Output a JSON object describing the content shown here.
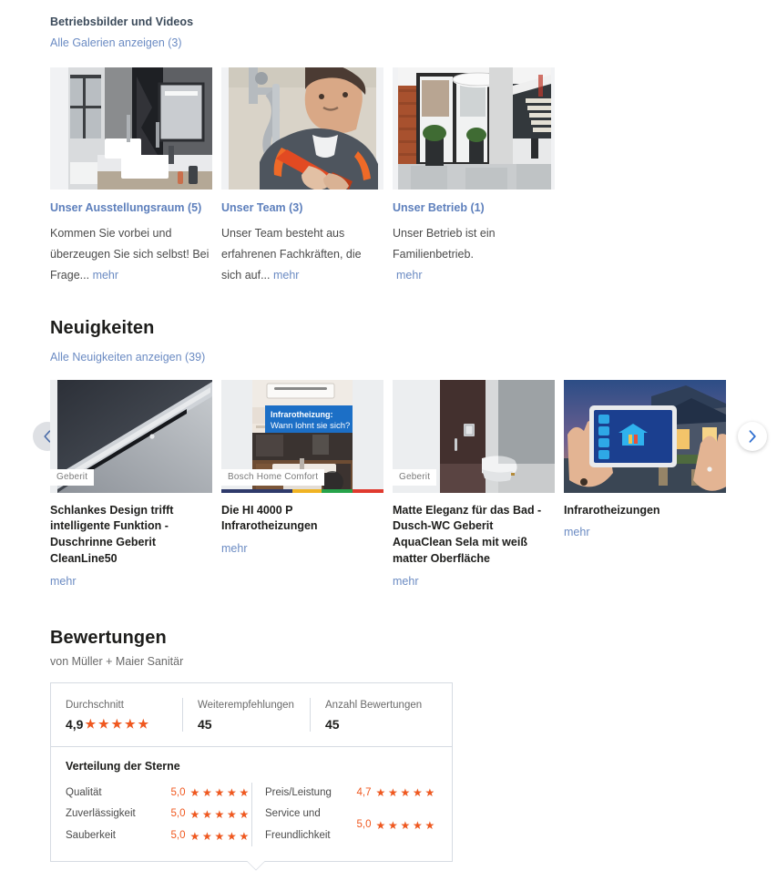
{
  "galleries": {
    "heading": "Betriebsbilder und Videos",
    "all_link": "Alle Galerien anzeigen (3)",
    "items": [
      {
        "title": "Unser Ausstellungsraum (5)",
        "desc": "Kommen Sie vorbei und überzeugen Sie sich selbst! Bei Frage...",
        "more": "mehr",
        "image_alt": "bathroom-showroom-photo"
      },
      {
        "title": "Unser Team (3)",
        "desc": "Unser Team besteht aus erfahrenen Fachkräften, die sich auf...",
        "more": "mehr",
        "image_alt": "plumber-at-work-photo"
      },
      {
        "title": "Unser Betrieb (1)",
        "desc": "Unser Betrieb ist ein Familienbetrieb.",
        "more": "mehr",
        "image_alt": "company-entrance-photo"
      }
    ]
  },
  "news": {
    "heading": "Neuigkeiten",
    "all_link": "Alle Neuigkeiten anzeigen (39)",
    "prev_label": "‹",
    "next_label": "›",
    "items": [
      {
        "title": "Schlankes Design trifft intelligente Funktion - Duschrinne Geberit CleanLine50",
        "more": "mehr",
        "brand": "Geberit",
        "image_alt": "shower-drain-photo"
      },
      {
        "title": "Die HI 4000 P Infrarotheizungen",
        "more": "mehr",
        "brand": "Bosch Home Comfort",
        "overlay_line1": "Infrarotheizung:",
        "overlay_line2": "Wann lohnt sie sich?",
        "image_alt": "infrared-heating-kitchen-photo"
      },
      {
        "title": "Matte Eleganz für das Bad - Dusch-WC Geberit AquaClean Sela mit weiß matter Oberfläche",
        "more": "mehr",
        "brand": "Geberit",
        "image_alt": "wall-hung-toilet-photo"
      },
      {
        "title": "Infrarotheizungen",
        "more": "mehr",
        "brand": "",
        "image_alt": "smart-home-tablet-photo"
      }
    ]
  },
  "ratings": {
    "heading": "Bewertungen",
    "subtitle": "von Müller + Maier Sanitär",
    "summary": [
      {
        "label": "Durchschnitt",
        "value": "4,9",
        "stars": 4.9,
        "has_stars": true
      },
      {
        "label": "Weiterempfehlungen",
        "value": "45",
        "stars": 0,
        "has_stars": false
      },
      {
        "label": "Anzahl Bewertungen",
        "value": "45",
        "stars": 0,
        "has_stars": false
      }
    ],
    "distribution_title": "Verteilung der Sterne",
    "distribution_left": [
      {
        "name": "Qualität",
        "score": "5,0",
        "stars": 5.0
      },
      {
        "name": "Zuverlässigkeit",
        "score": "5,0",
        "stars": 5.0
      },
      {
        "name": "Sauberkeit",
        "score": "5,0",
        "stars": 5.0
      }
    ],
    "distribution_right": [
      {
        "name": "Preis/Leistung",
        "score": "4,7",
        "stars": 4.7
      },
      {
        "name": "Service und Freundlichkeit",
        "score": "5,0",
        "stars": 5.0
      }
    ]
  },
  "colors": {
    "star": "#f0581f",
    "link": "#6b8bc3",
    "gallery_title": "#5d7fbc",
    "heading": "#1d1d1b",
    "border": "#d6dbe2"
  }
}
